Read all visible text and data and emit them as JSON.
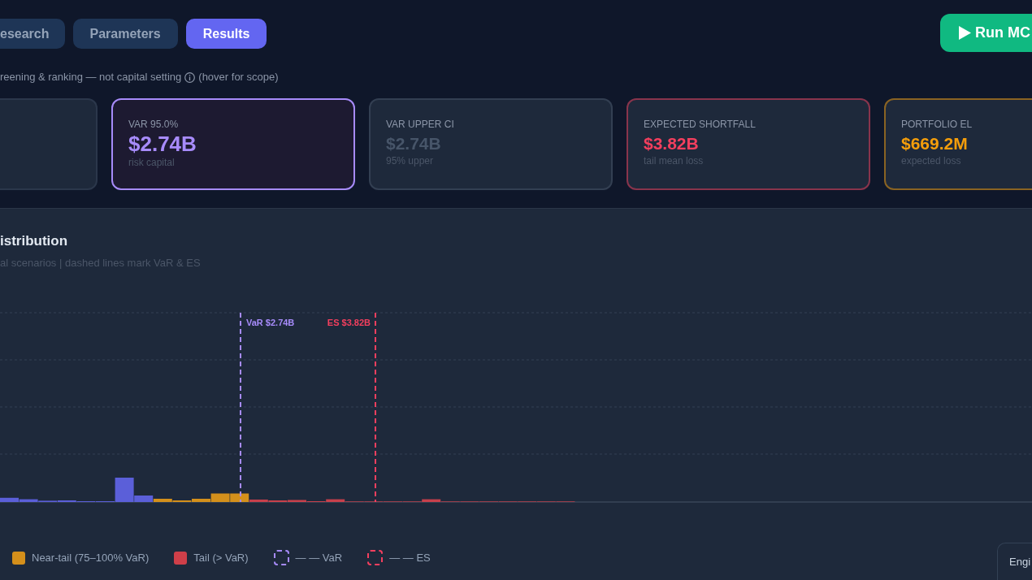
{
  "tabs": [
    {
      "label": "esearch",
      "selected": false
    },
    {
      "label": "Parameters",
      "selected": false
    },
    {
      "label": "Results",
      "selected": true
    }
  ],
  "run_button": {
    "label": "Run MC"
  },
  "scope_note": {
    "text": "reening & ranking — not capital setting",
    "hint": "(hover for scope)"
  },
  "cards": [
    {
      "selected": false
    },
    {
      "label": "VAR 95.0%",
      "value": "$2.74B",
      "caption": "risk capital",
      "color": "#a78bfa",
      "selected": true
    },
    {
      "label": "VAR UPPER CI",
      "value": "$2.74B",
      "caption": "95% upper",
      "color": "#475569",
      "selected": false
    },
    {
      "label": "EXPECTED SHORTFALL",
      "value": "$3.82B",
      "caption": "tail mean loss",
      "color": "#f43f5e",
      "selected": false
    },
    {
      "label": "PORTFOLIO EL",
      "value": "$669.2M",
      "caption": "expected loss",
      "color": "#f59e0b",
      "selected": false
    }
  ],
  "chart_panel": {
    "title": "istribution",
    "subtitle": "al scenarios | dashed lines mark VaR & ES",
    "markers": [
      {
        "kind": "var",
        "label": "VaR $2.74B",
        "color": "#a78bfa"
      },
      {
        "kind": "es",
        "label": "ES $3.82B",
        "color": "#f43f5e"
      }
    ],
    "legend": [
      {
        "kind": "fill",
        "label": "Near-tail (75–100% VaR)",
        "color": "#d48f1b"
      },
      {
        "kind": "fill",
        "label": "Tail (> VaR)",
        "color": "#cf3f49"
      },
      {
        "kind": "dashed",
        "label": "— — VaR",
        "color": "#a78bfa"
      },
      {
        "kind": "dashed",
        "label": "— — ES",
        "color": "#f43f5e"
      }
    ]
  },
  "corner_button": {
    "label": "Engi"
  }
}
